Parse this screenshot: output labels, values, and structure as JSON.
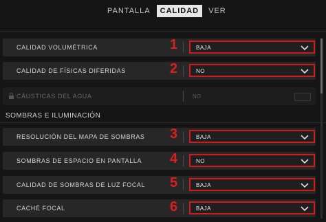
{
  "tabs": [
    {
      "label": "PANTALLA",
      "active": false
    },
    {
      "label": "CALIDAD",
      "active": true
    },
    {
      "label": "VER",
      "active": false
    }
  ],
  "settings": [
    {
      "label": "CALIDAD VOLUMÉTRICA",
      "value": "BAJA",
      "marker": "1"
    },
    {
      "label": "CALIDAD DE FÍSICAS DIFERIDAS",
      "value": "NO",
      "marker": "2"
    },
    {
      "label": "CÁUSTICAS DEL AGUA",
      "value": "NO",
      "disabled": true
    }
  ],
  "section_title": "SOMBRAS E ILUMINACIÓN",
  "shadow_settings": [
    {
      "label": "RESOLUCIÓN DEL MAPA DE SOMBRAS",
      "value": "BAJA",
      "marker": "3"
    },
    {
      "label": "SOMBRAS DE ESPACIO EN PANTALLA",
      "value": "NO",
      "marker": "4"
    },
    {
      "label": "CALIDAD DE SOMBRAS DE LUZ FOCAL",
      "value": "BAJA",
      "marker": "5"
    },
    {
      "label": "CACHÉ FOCAL",
      "value": "BAJA",
      "marker": "6"
    }
  ],
  "colors": {
    "highlight": "#cf1b1b",
    "row_bg": "#272727",
    "bg": "#151515"
  },
  "icons": {
    "dropdown": "chevron-down-icon",
    "locked": "lock-icon"
  }
}
